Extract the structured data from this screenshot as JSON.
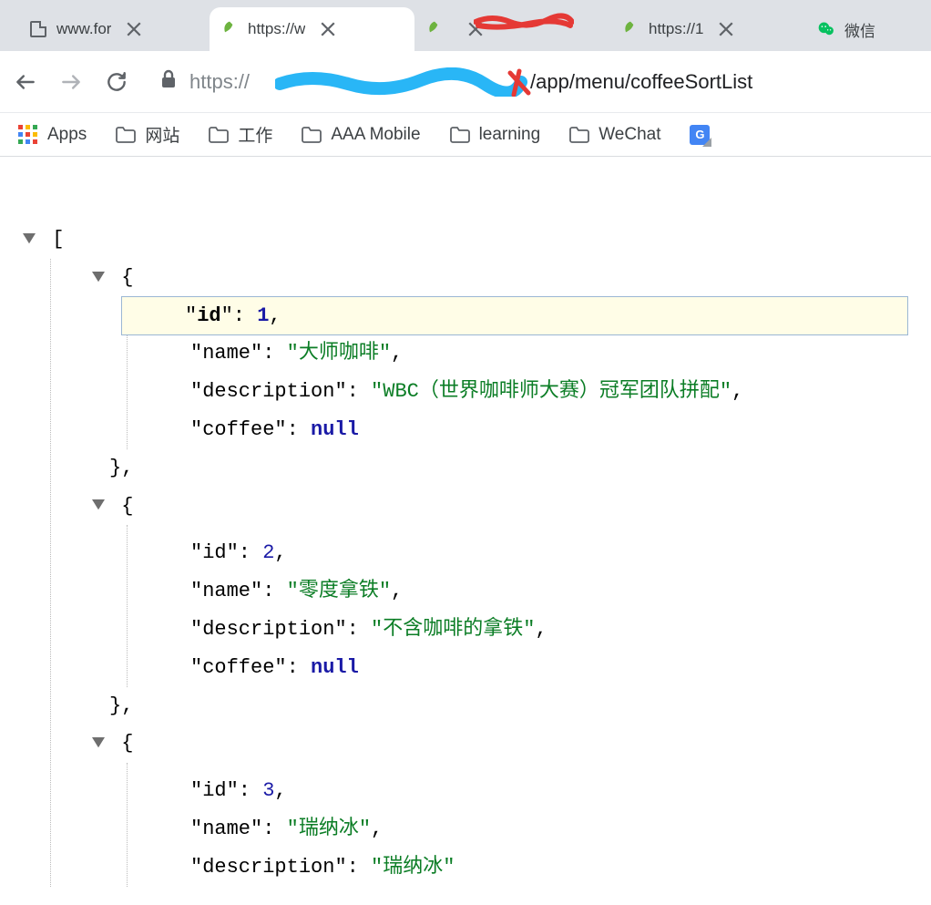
{
  "tabs": [
    {
      "title": "www.for",
      "icon": "file"
    },
    {
      "title": "https://w",
      "icon": "leaf",
      "active": true
    },
    {
      "title": "",
      "icon": "leaf"
    },
    {
      "title": "https://1",
      "icon": "leaf"
    },
    {
      "title": "微信",
      "icon": "wechat"
    }
  ],
  "url_scheme": "https://",
  "url_path": "/app/menu/coffeeSortList",
  "bookmarks": {
    "apps": "Apps",
    "items": [
      "网站",
      "工作",
      "AAA Mobile",
      "learning",
      "WeChat"
    ]
  },
  "json": {
    "items": [
      {
        "id": 1,
        "name": "大师咖啡",
        "description": "WBC（世界咖啡师大赛）冠军团队拼配",
        "coffee": null
      },
      {
        "id": 2,
        "name": "零度拿铁",
        "description": "不含咖啡的拿铁",
        "coffee": null
      },
      {
        "id": 3,
        "name": "瑞纳冰",
        "description": "瑞纳冰"
      }
    ],
    "labels": {
      "id": "id",
      "name": "name",
      "description": "description",
      "coffee": "coffee",
      "null": "null"
    }
  }
}
